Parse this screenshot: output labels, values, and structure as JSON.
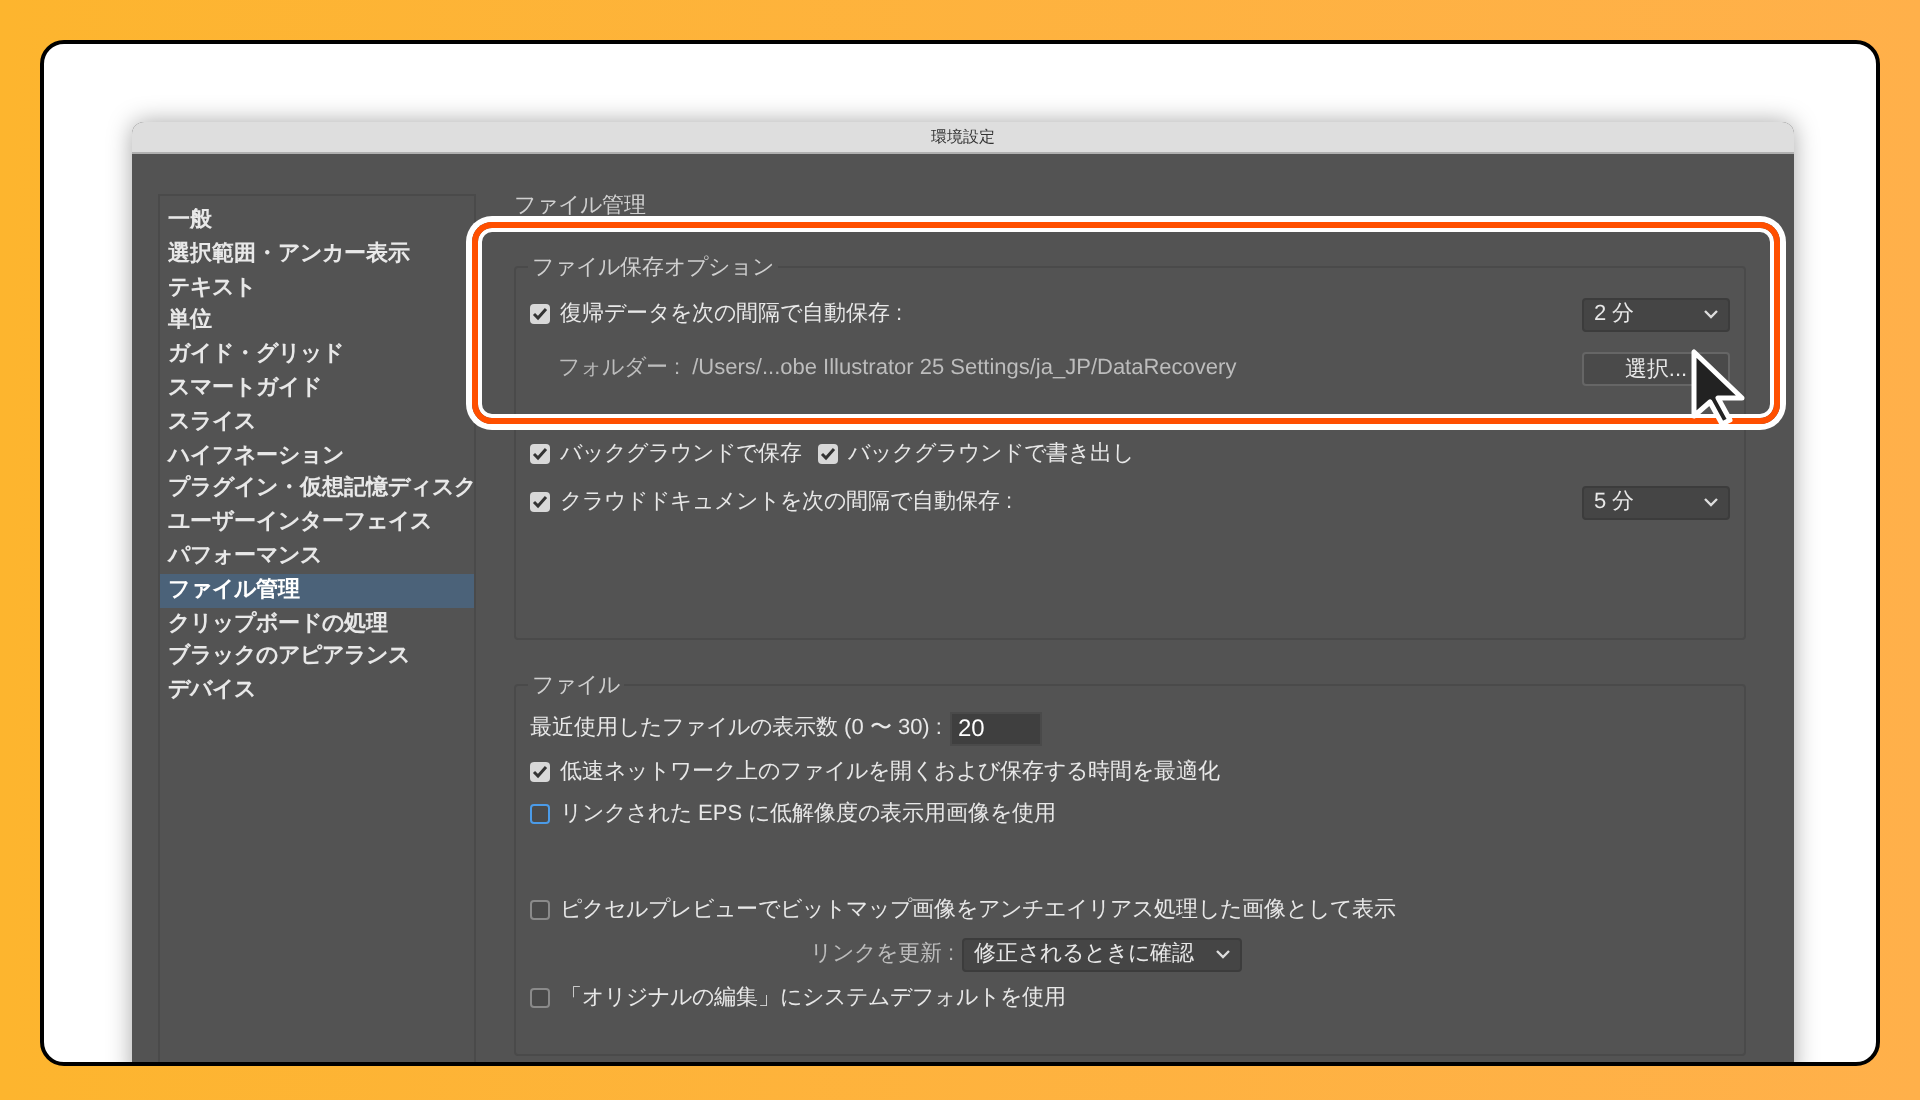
{
  "window": {
    "title": "環境設定"
  },
  "sidebar": {
    "items": [
      {
        "label": "一般",
        "selected": false
      },
      {
        "label": "選択範囲・アンカー表示",
        "selected": false
      },
      {
        "label": "テキスト",
        "selected": false
      },
      {
        "label": "単位",
        "selected": false
      },
      {
        "label": "ガイド・グリッド",
        "selected": false
      },
      {
        "label": "スマートガイド",
        "selected": false
      },
      {
        "label": "スライス",
        "selected": false
      },
      {
        "label": "ハイフネーション",
        "selected": false
      },
      {
        "label": "プラグイン・仮想記憶ディスク",
        "selected": false
      },
      {
        "label": "ユーザーインターフェイス",
        "selected": false
      },
      {
        "label": "パフォーマンス",
        "selected": false
      },
      {
        "label": "ファイル管理",
        "selected": true
      },
      {
        "label": "クリップボードの処理",
        "selected": false
      },
      {
        "label": "ブラックのアピアランス",
        "selected": false
      },
      {
        "label": "デバイス",
        "selected": false
      }
    ]
  },
  "panel": {
    "title": "ファイル管理",
    "groups": [
      {
        "title": "ファイル保存オプション",
        "rows": [
          {
            "kind": "checkbox-select",
            "checks": [
              {
                "label": "復帰データを次の間隔で自動保存 :",
                "checked": true,
                "focused": false
              }
            ],
            "select": "2 分"
          },
          {
            "kind": "folder",
            "label": "フォルダー :",
            "path": "/Users/...obe Illustrator 25 Settings/ja_JP/DataRecovery",
            "button": "選択..."
          },
          {
            "kind": "hidden"
          },
          {
            "kind": "checks",
            "checks": [
              {
                "label": "バックグラウンドで保存",
                "checked": true,
                "focused": false
              },
              {
                "label": "バックグラウンドで書き出し",
                "checked": true,
                "focused": false
              }
            ]
          },
          {
            "kind": "checkbox-select",
            "checks": [
              {
                "label": "クラウドドキュメントを次の間隔で自動保存 :",
                "checked": true,
                "focused": false
              }
            ],
            "select": "5 分"
          }
        ]
      },
      {
        "title": "ファイル",
        "rows": [
          {
            "kind": "number",
            "label": "最近使用したファイルの表示数 (0 〜 30) :",
            "value": "20"
          },
          {
            "kind": "checks",
            "checks": [
              {
                "label": "低速ネットワーク上のファイルを開くおよび保存する時間を最適化",
                "checked": true,
                "focused": false
              }
            ]
          },
          {
            "kind": "checks",
            "checks": [
              {
                "label": "リンクされた EPS に低解像度の表示用画像を使用",
                "checked": false,
                "focused": true
              }
            ]
          },
          {
            "kind": "spacer"
          },
          {
            "kind": "checks",
            "checks": [
              {
                "label": "ピクセルプレビューでビットマップ画像をアンチエイリアス処理した画像として表示",
                "checked": false,
                "focused": false
              }
            ]
          },
          {
            "kind": "dropdown",
            "label": "リンクを更新 :",
            "select": "修正されるときに確認"
          },
          {
            "kind": "checks",
            "checks": [
              {
                "label": "「オリジナルの編集」にシステムデフォルトを使用",
                "checked": false,
                "focused": false
              }
            ]
          }
        ]
      }
    ]
  }
}
